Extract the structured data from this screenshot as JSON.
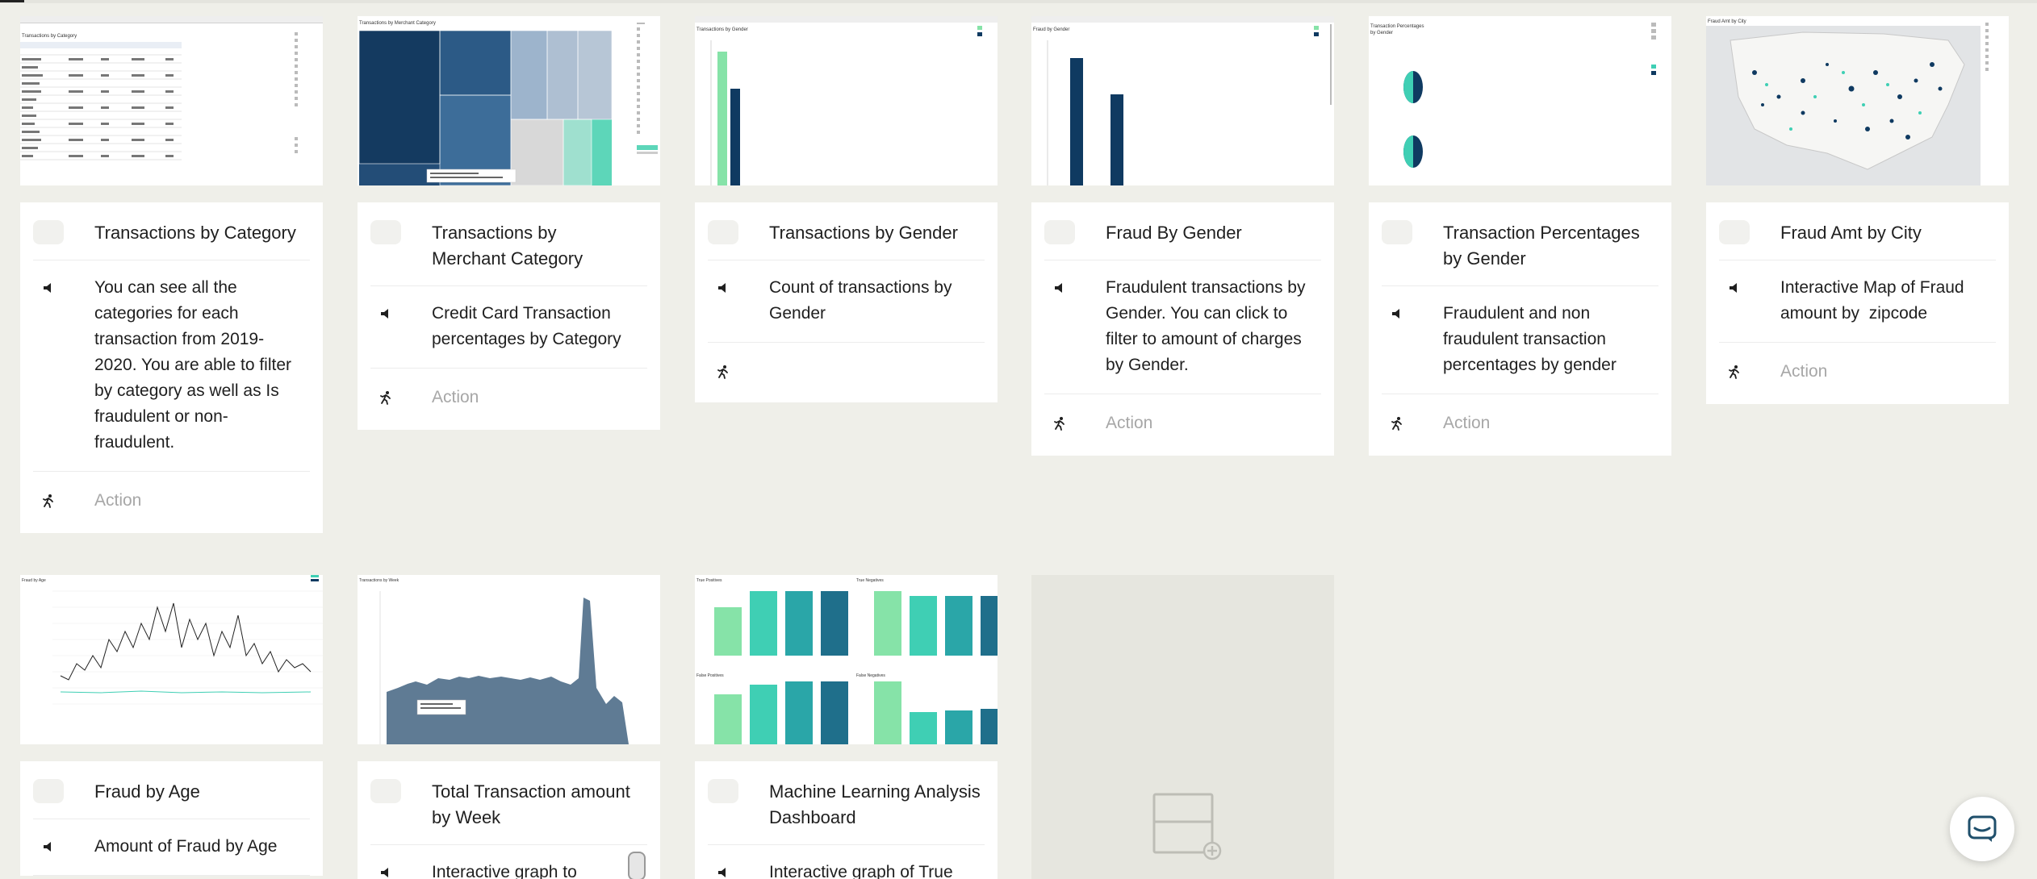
{
  "gallery": {
    "cards": [
      {
        "title": "Transactions by Category",
        "desc": "You can see all the categories for each transaction from 2019-2020. You are able to filter by category as well as Is fraudulent or non-fraudulent.",
        "action": "Action",
        "thumb": "table"
      },
      {
        "title": "Transactions by Merchant Category",
        "desc": "Credit Card Transaction percentages by Category",
        "action": "Action",
        "thumb": "treemap"
      },
      {
        "title": "Transactions by Gender",
        "desc": "Count of transactions by Gender",
        "action": "",
        "thumb": "gender-bars"
      },
      {
        "title": "Fraud By Gender",
        "desc": "Fraudulent transactions by Gender. You can click to filter to amount of charges by Gender.",
        "action": "Action",
        "thumb": "fraud-gender"
      },
      {
        "title": "Transaction Percentages by Gender",
        "desc": "Fraudulent and non fraudulent transaction percentages by gender",
        "action": "Action",
        "thumb": "pies"
      },
      {
        "title": "Fraud Amt by City",
        "desc": "Interactive Map of Fraud amount by  zipcode",
        "action": "Action",
        "thumb": "map"
      },
      {
        "title": "Fraud by Age",
        "desc": "Amount of Fraud by Age",
        "action": "",
        "thumb": "line"
      },
      {
        "title": "Total Transaction amount by Week",
        "desc": "Interactive graph to",
        "action": "",
        "thumb": "area"
      },
      {
        "title": "Machine Learning Analysis Dashboard",
        "desc": "Interactive graph of True",
        "action": "",
        "thumb": "ml"
      }
    ]
  },
  "colors": {
    "navy": "#0f3a61",
    "teal": "#3fcfb4",
    "mint": "#86e3a8",
    "accent": "#1f6f8b",
    "muted": "#a7a7a7"
  },
  "icons": {
    "speaker": "speaker-icon",
    "runner": "runner-icon",
    "add": "add-card-icon",
    "chat": "chat-icon"
  }
}
